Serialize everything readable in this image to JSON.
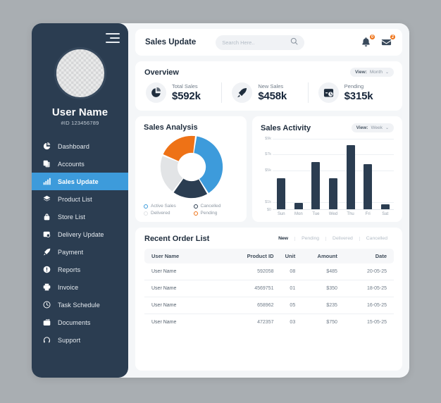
{
  "sidebar": {
    "menu_icon": "hamburger-icon",
    "avatar": "user-avatar-placeholder",
    "user_name": "User Name",
    "user_id": "#ID 123456789",
    "items": [
      {
        "label": "Dashboard",
        "icon": "pie-chart-icon",
        "active": false
      },
      {
        "label": "Accounts",
        "icon": "copy-icon",
        "active": false
      },
      {
        "label": "Sales Update",
        "icon": "bar-chart-icon",
        "active": true
      },
      {
        "label": "Product List",
        "icon": "layers-icon",
        "active": false
      },
      {
        "label": "Store List",
        "icon": "lock-icon",
        "active": false
      },
      {
        "label": "Delivery Update",
        "icon": "delivery-box-icon",
        "active": false
      },
      {
        "label": "Payment",
        "icon": "rocket-icon",
        "active": false
      },
      {
        "label": "Reports",
        "icon": "info-icon",
        "active": false
      },
      {
        "label": "Invoice",
        "icon": "printer-icon",
        "active": false
      },
      {
        "label": "Task Schedule",
        "icon": "clock-icon",
        "active": false
      },
      {
        "label": "Documents",
        "icon": "briefcase-icon",
        "active": false
      },
      {
        "label": "Support",
        "icon": "headset-icon",
        "active": false
      }
    ]
  },
  "topbar": {
    "title": "Sales Update",
    "search_placeholder": "Search Here..",
    "search_value": "",
    "search_icon": "search-icon",
    "bell_icon": "bell-icon",
    "bell_badge": "0",
    "mail_icon": "mail-icon",
    "mail_badge": "2"
  },
  "overview": {
    "title": "Overview",
    "view": {
      "label": "View:",
      "value": "Month",
      "caret": "⌄"
    },
    "stats": [
      {
        "label": "Total Sales",
        "value": "$592k",
        "icon": "pie-chart-icon"
      },
      {
        "label": "New Sales",
        "value": "$458k",
        "icon": "rocket-icon"
      },
      {
        "label": "Pending",
        "value": "$315k",
        "icon": "calendar-clock-icon"
      }
    ]
  },
  "sales_analysis": {
    "title": "Sales Analysis",
    "legend": [
      {
        "label": "Active Sales",
        "color": "#3d9bdb"
      },
      {
        "label": "Cancelled",
        "color": "#2b3d51"
      },
      {
        "label": "Delivered",
        "color": "#e2e4e6"
      },
      {
        "label": "Pending",
        "color": "#ee7216"
      }
    ]
  },
  "sales_activity": {
    "title": "Sales Activity",
    "view": {
      "label": "View:",
      "value": "Week",
      "caret": "⌄"
    }
  },
  "orders": {
    "title": "Recent Order List",
    "tabs": [
      {
        "label": "New",
        "active": true
      },
      {
        "label": "Pending",
        "active": false
      },
      {
        "label": "Delivered",
        "active": false
      },
      {
        "label": "Cancelled",
        "active": false
      }
    ],
    "columns": [
      "User Name",
      "Product ID",
      "Unit",
      "Amount",
      "Date"
    ],
    "rows": [
      [
        "User Name",
        "592058",
        "08",
        "$485",
        "20-05-25"
      ],
      [
        "User Name",
        "4569751",
        "01",
        "$350",
        "18-05-25"
      ],
      [
        "User Name",
        "658962",
        "05",
        "$235",
        "16-05-25"
      ],
      [
        "User Name",
        "472357",
        "03",
        "$750",
        "15-05-25"
      ]
    ]
  },
  "chart_data": [
    {
      "type": "pie",
      "title": "Sales Analysis",
      "labels": [
        "Active Sales",
        "Cancelled",
        "Delivered",
        "Pending"
      ],
      "values": [
        39,
        19,
        21,
        21
      ],
      "colors": [
        "#3d9bdb",
        "#2b3d51",
        "#e2e4e6",
        "#ee7216"
      ],
      "donut": true,
      "legend_position": "bottom"
    },
    {
      "type": "bar",
      "title": "Sales Activity",
      "categories": [
        "Sun",
        "Mon",
        "Tue",
        "Wed",
        "Thu",
        "Fri",
        "Sat"
      ],
      "values": [
        4.0,
        0.8,
        6.0,
        4.0,
        8.2,
        5.8,
        0.6
      ],
      "ytick_labels": [
        "$0",
        "$1k",
        "$5k",
        "$7k",
        "$9k"
      ],
      "ytick_values": [
        0,
        1,
        5,
        7,
        9
      ],
      "ylim": [
        0,
        9
      ],
      "xlabel": "",
      "ylabel": "",
      "grid": true,
      "bar_color": "#2b3d51"
    }
  ]
}
